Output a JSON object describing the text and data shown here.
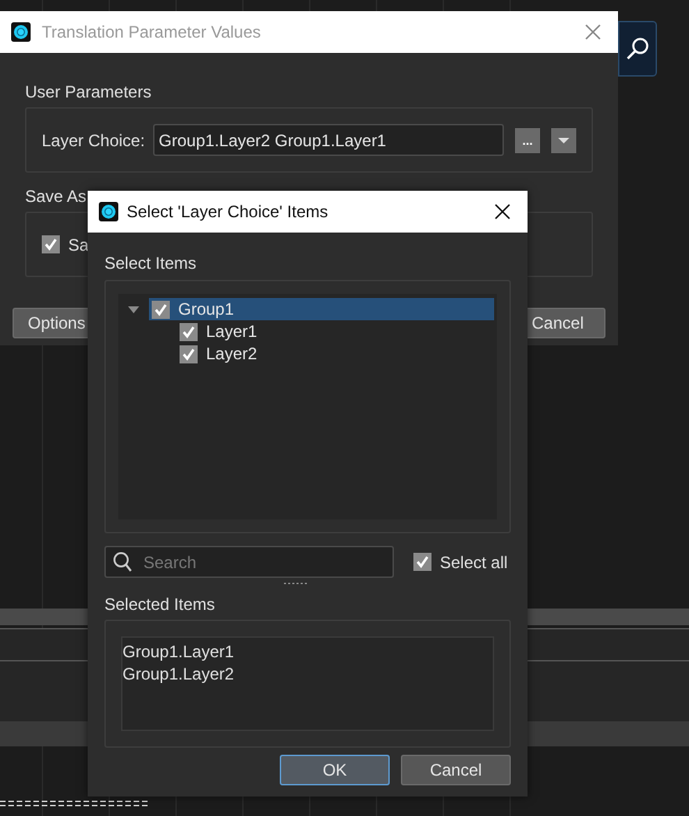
{
  "back_window": {
    "title": "Translation Parameter Values",
    "user_parameters": {
      "heading": "User Parameters",
      "label": "Layer Choice:",
      "value": "Group1.Layer2 Group1.Layer1",
      "browse_button": "..."
    },
    "save_section": {
      "heading": "Save As",
      "checkbox": {
        "label": "Sa",
        "checked": true
      }
    },
    "buttons": [
      "Options",
      "Cancel"
    ]
  },
  "dialog": {
    "title": "Select 'Layer Choice' Items",
    "tree_heading": "Select Items",
    "tree": [
      {
        "label": "Group1",
        "checked": true,
        "expanded": true,
        "selected": true,
        "children": [
          {
            "label": "Layer1",
            "checked": true,
            "selected": false
          },
          {
            "label": "Layer2",
            "checked": true,
            "selected": false
          }
        ]
      }
    ],
    "search": {
      "placeholder": "Search"
    },
    "select_all": {
      "label": "Select all",
      "checked": true
    },
    "selected_heading": "Selected Items",
    "selected_items": [
      "Group1.Layer1",
      "Group1.Layer2"
    ],
    "buttons": [
      {
        "label": "OK",
        "default": true
      },
      {
        "label": "Cancel",
        "default": false
      }
    ]
  }
}
